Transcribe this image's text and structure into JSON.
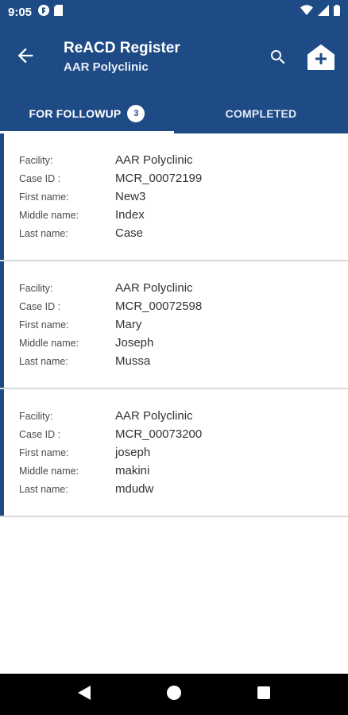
{
  "status_bar": {
    "time": "9:05",
    "icons": [
      "app-notification-icon",
      "sim-card-icon",
      "wifi-icon",
      "signal-icon",
      "battery-icon"
    ]
  },
  "app_bar": {
    "title": "ReACD Register",
    "subtitle": "AAR Polyclinic",
    "color": "#1e4b85"
  },
  "tabs": [
    {
      "label": "FOR FOLLOWUP",
      "badge": "3",
      "active": true
    },
    {
      "label": "COMPLETED",
      "active": false
    }
  ],
  "field_labels": {
    "facility": "Facility:",
    "case_id": "Case ID :",
    "first_name": "First name:",
    "middle_name": "Middle name:",
    "last_name": "Last name:"
  },
  "cases": [
    {
      "facility": "AAR Polyclinic",
      "case_id": "MCR_00072199",
      "first_name": "New3",
      "middle_name": "Index",
      "last_name": "Case"
    },
    {
      "facility": "AAR Polyclinic",
      "case_id": "MCR_00072598",
      "first_name": "Mary",
      "middle_name": "Joseph",
      "last_name": "Mussa"
    },
    {
      "facility": "AAR Polyclinic",
      "case_id": "MCR_00073200",
      "first_name": "joseph",
      "middle_name": "makini",
      "last_name": "mdudw"
    }
  ],
  "nav_bar": [
    "back-triangle-icon",
    "home-circle-icon",
    "recents-square-icon"
  ]
}
